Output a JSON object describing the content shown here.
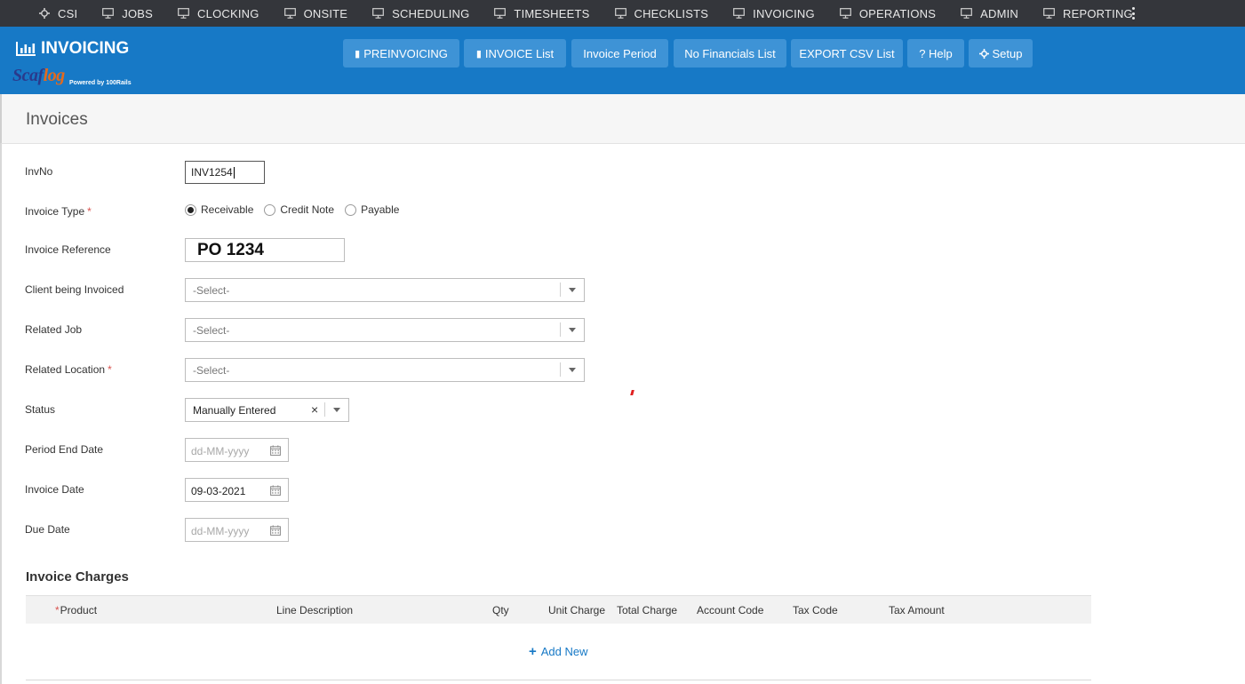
{
  "topnav": {
    "items": [
      {
        "label": "CSI",
        "icon": "gear-icon"
      },
      {
        "label": "JOBS",
        "icon": "monitor-icon"
      },
      {
        "label": "CLOCKING",
        "icon": "monitor-icon"
      },
      {
        "label": "ONSITE",
        "icon": "monitor-icon"
      },
      {
        "label": "SCHEDULING",
        "icon": "monitor-icon"
      },
      {
        "label": "TIMESHEETS",
        "icon": "monitor-icon"
      },
      {
        "label": "CHECKLISTS",
        "icon": "monitor-icon"
      },
      {
        "label": "INVOICING",
        "icon": "monitor-icon"
      },
      {
        "label": "OPERATIONS",
        "icon": "monitor-icon"
      },
      {
        "label": "ADMIN",
        "icon": "monitor-icon"
      },
      {
        "label": "REPORTING",
        "icon": "monitor-icon"
      }
    ],
    "more_icon": "vertical-dots-icon"
  },
  "header": {
    "module_title": "INVOICING",
    "logo": {
      "word_main": "Scaf",
      "word_accent": "log",
      "powered_by": "Powered by 100Rails"
    },
    "buttons": {
      "preinvoicing": "PREINVOICING",
      "invoice_list": "INVOICE List",
      "invoice_period": "Invoice Period",
      "no_financials": "No Financials List",
      "export_csv": "EXPORT CSV List",
      "help": "? Help",
      "setup": "Setup"
    },
    "colors": {
      "bar": "#1779c6",
      "button": "#3e93d6",
      "nav": "#34363b"
    }
  },
  "page": {
    "title": "Invoices"
  },
  "form": {
    "invno": {
      "label": "InvNo",
      "value": "INV1254"
    },
    "invoice_type": {
      "label": "Invoice Type",
      "required_mark": "*",
      "options": [
        "Receivable",
        "Credit Note",
        "Payable"
      ],
      "selected": "Receivable"
    },
    "invoice_reference": {
      "label": "Invoice Reference",
      "value": "PO 1234"
    },
    "client": {
      "label": "Client being Invoiced",
      "value": "-Select-"
    },
    "related_job": {
      "label": "Related Job",
      "value": "-Select-"
    },
    "related_location": {
      "label": "Related Location",
      "required_mark": "*",
      "value": "-Select-"
    },
    "status": {
      "label": "Status",
      "value": "Manually Entered",
      "clear": "×"
    },
    "period_end_date": {
      "label": "Period End Date",
      "placeholder": "dd-MM-yyyy"
    },
    "invoice_date": {
      "label": "Invoice Date",
      "value": "09-03-2021"
    },
    "due_date": {
      "label": "Due Date",
      "placeholder": "dd-MM-yyyy"
    }
  },
  "charges": {
    "title": "Invoice Charges",
    "required_mark": "*",
    "columns": [
      "Product",
      "Line Description",
      "Qty",
      "Unit Charge",
      "Total Charge",
      "Account Code",
      "Tax Code",
      "Tax Amount"
    ],
    "add_new": "Add New"
  }
}
